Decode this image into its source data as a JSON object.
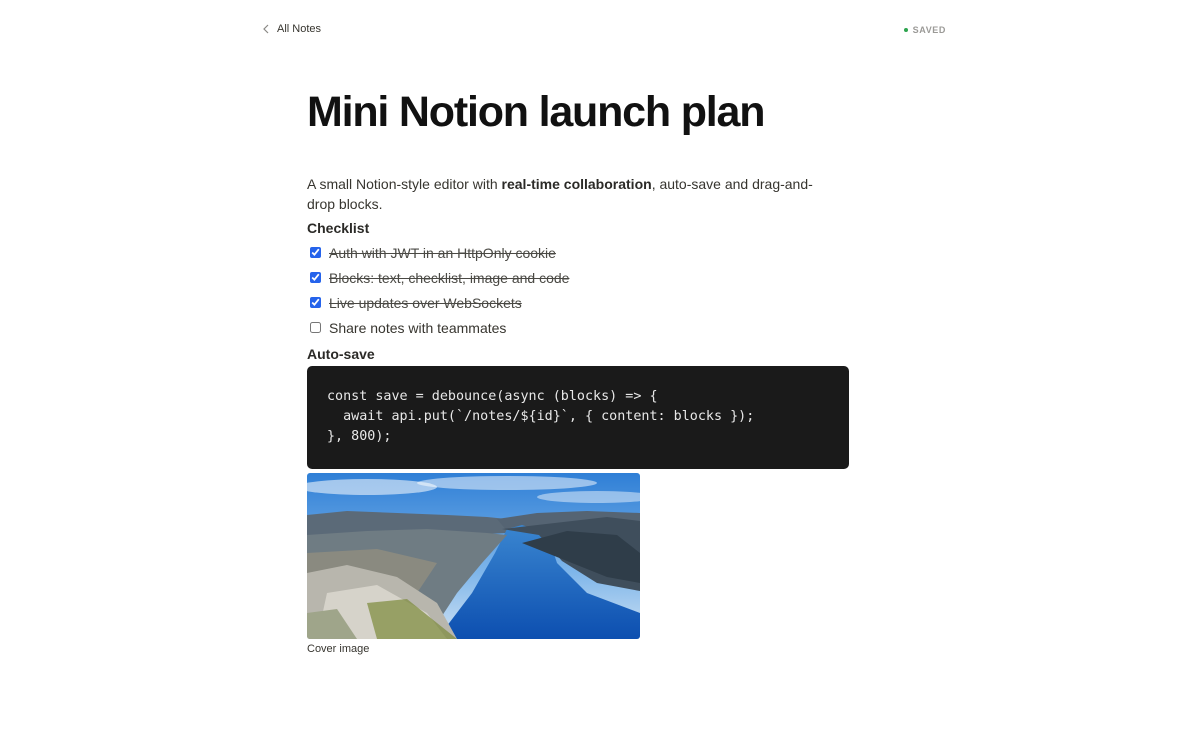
{
  "nav": {
    "back_label": "All Notes",
    "back_icon": "chevron-left-icon"
  },
  "status": {
    "label": "SAVED",
    "color": "#2da44e"
  },
  "note": {
    "title": "Mini Notion launch plan",
    "intro_before": "A small Notion-style editor with ",
    "intro_bold": "real-time collaboration",
    "intro_after": ", auto-save and drag-and-drop blocks.",
    "checklist_heading": "Checklist",
    "checklist": [
      {
        "label": "Auth with JWT in an HttpOnly cookie",
        "checked": true
      },
      {
        "label": "Blocks: text, checklist, image and code",
        "checked": true
      },
      {
        "label": "Live updates over WebSockets",
        "checked": true
      },
      {
        "label": "Share notes with teammates",
        "checked": false
      }
    ],
    "code_heading": "Auto-save",
    "code": "const save = debounce(async (blocks) => {\n  await api.put(`/notes/${id}`, { content: blocks });\n}, 800);",
    "image_caption": "Cover image"
  }
}
